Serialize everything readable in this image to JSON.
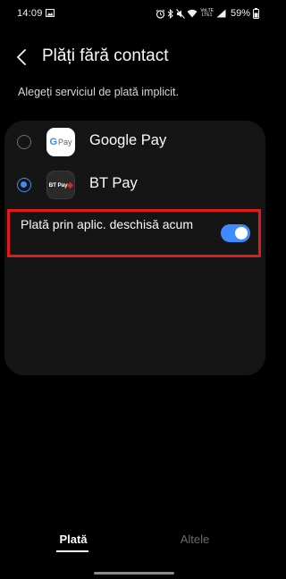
{
  "status_bar": {
    "time": "14:09",
    "network_label_top": "VoLTE",
    "network_label_bottom": "LTE1",
    "battery_percent": "59%"
  },
  "header": {
    "title": "Plăți fără contact"
  },
  "description": "Alegeți serviciul de plată implicit.",
  "payment_apps": [
    {
      "name": "Google Pay",
      "selected": false,
      "icon": "google-pay-icon",
      "icon_text": "G Pay"
    },
    {
      "name": "BT Pay",
      "selected": true,
      "icon": "bt-pay-icon",
      "icon_text": "BT Pay"
    }
  ],
  "option": {
    "label": "Plată prin aplic. deschisă acum",
    "enabled": true
  },
  "tabs": [
    {
      "label": "Plată",
      "active": true
    },
    {
      "label": "Altele",
      "active": false
    }
  ],
  "colors": {
    "accent": "#3e8bff",
    "highlight": "#e01b1b",
    "card_bg": "#151515",
    "background": "#000000"
  }
}
